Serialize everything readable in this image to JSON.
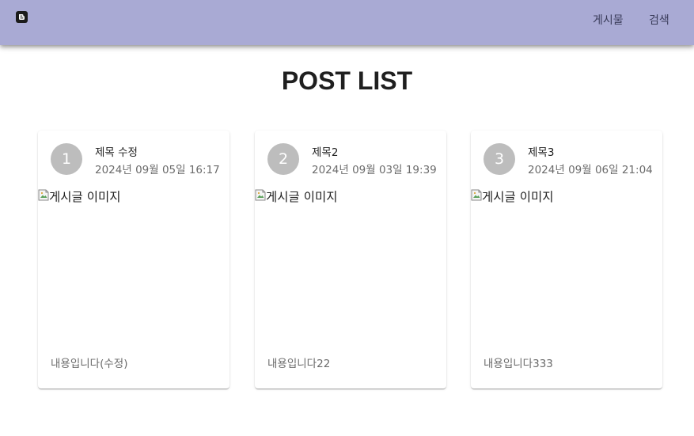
{
  "appbar": {
    "logo_icon": "blogger-icon",
    "nav": {
      "posts": "게시물",
      "search": "검색"
    },
    "colors": {
      "background": "#a9aad4",
      "text": "#3a3c5a"
    }
  },
  "main": {
    "title": "POST LIST"
  },
  "posts": [
    {
      "number": "1",
      "title": "제목 수정",
      "date": "2024년 09월 05일 16:17",
      "image_alt": "게시글 이미지",
      "content": "내용입니다(수정)"
    },
    {
      "number": "2",
      "title": "제목2",
      "date": "2024년 09월 03일 19:39",
      "image_alt": "게시글 이미지",
      "content": "내용입니다22"
    },
    {
      "number": "3",
      "title": "제목3",
      "date": "2024년 09월 06일 21:04",
      "image_alt": "게시글 이미지",
      "content": "내용입니다333"
    }
  ],
  "colors": {
    "avatar": "#bdbdbd",
    "secondary_text": "#6b6b6b"
  }
}
